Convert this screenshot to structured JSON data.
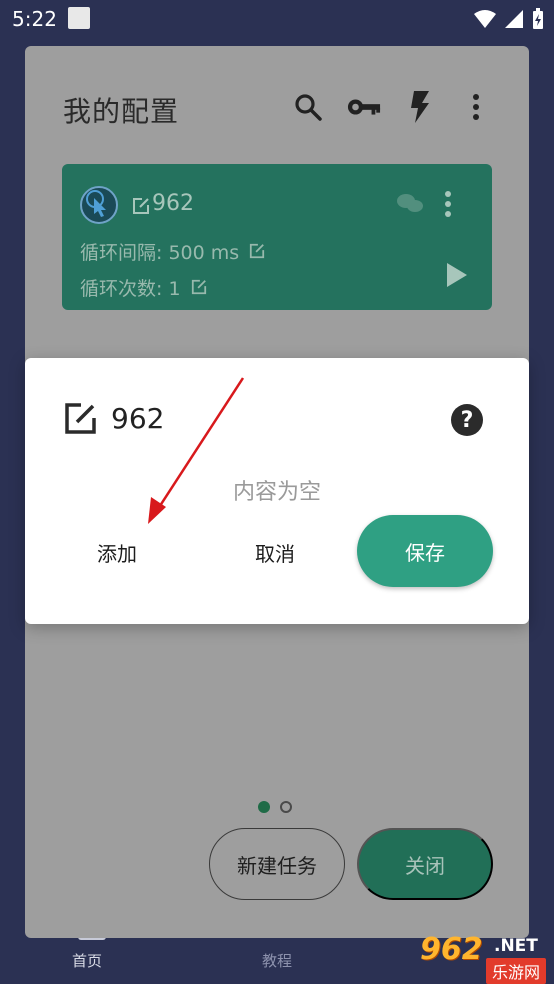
{
  "status_bar": {
    "time": "5:22"
  },
  "bottom_nav": {
    "home": "首页",
    "tutorial": "教程"
  },
  "sheet": {
    "title": "我的配置",
    "toolbar_icons": [
      "search-icon",
      "key-icon",
      "flash-icon",
      "more-vert-icon"
    ]
  },
  "config_card": {
    "name": "962",
    "interval_label": "循环间隔: 500 ms",
    "count_label": "循环次数: 1"
  },
  "pager": {
    "pages": 2,
    "active_index": 0
  },
  "actions": {
    "new_task": "新建任务",
    "close": "关闭"
  },
  "dialog": {
    "title": "962",
    "empty_text": "内容为空",
    "add": "添加",
    "cancel": "取消",
    "save": "保存"
  },
  "watermark": {
    "brand": "962",
    "suffix": ".NET",
    "sub": "乐游网"
  },
  "colors": {
    "status_bg": "#2b3153",
    "card_green": "#24725e",
    "save_green": "#2fa083",
    "arrow_red": "#d8191c"
  }
}
